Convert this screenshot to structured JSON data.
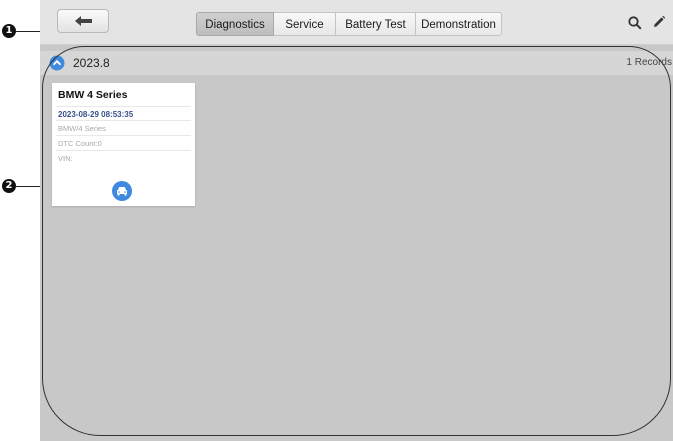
{
  "callouts": [
    "1",
    "2"
  ],
  "toolbar": {
    "back_icon": "arrow-left-icon",
    "tabs": [
      {
        "label": "Diagnostics",
        "active": true
      },
      {
        "label": "Service",
        "active": false
      },
      {
        "label": "Battery Test",
        "active": false
      },
      {
        "label": "Demonstration",
        "active": false
      }
    ],
    "search_icon": "search-icon",
    "edit_icon": "pencil-icon"
  },
  "group": {
    "date": "2023.8",
    "records": "1 Records",
    "collapse_icon": "chevron-up-icon"
  },
  "records": [
    {
      "title": "BMW 4 Series",
      "datetime": "2023-08-29 08:53:35",
      "model": "BMW/4 Series",
      "dtc": "DTC Count:0",
      "vin": "VIN:",
      "vehicle_icon": "car-icon"
    }
  ],
  "colors": {
    "accent": "#3f8ae0",
    "background": "#c8c8c8",
    "date_text": "#39508a"
  }
}
